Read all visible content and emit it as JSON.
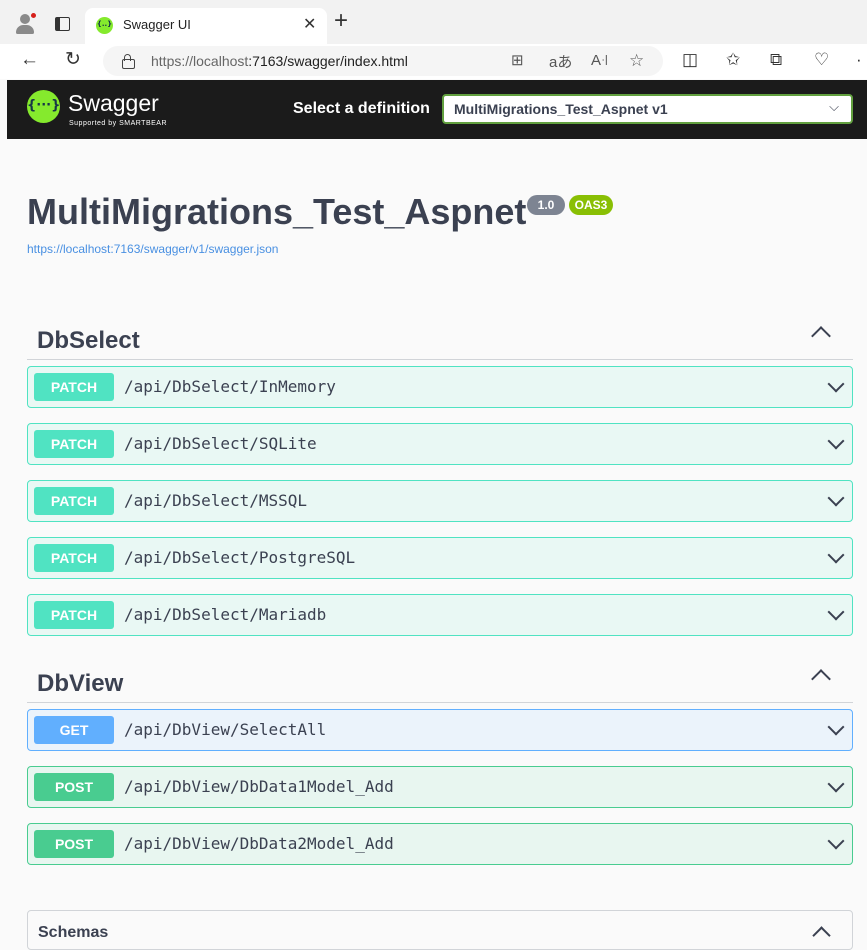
{
  "browser": {
    "tab_title": "Swagger UI",
    "tab_close": "✕",
    "new_tab": "+",
    "url_host": "https://localhost",
    "url_rest": ":7163/swagger/index.html"
  },
  "swagger": {
    "brand": "Swagger",
    "brand_sub": "Supported by SMARTBEAR",
    "definition_label": "Select a definition",
    "definition_value": "MultiMigrations_Test_Aspnet v1"
  },
  "info": {
    "title": "MultiMigrations_Test_Aspnet",
    "version": "1.0",
    "oas": "OAS3",
    "spec_url": "https://localhost:7163/swagger/v1/swagger.json"
  },
  "sections": [
    {
      "name": "DbSelect",
      "operations": [
        {
          "method": "PATCH",
          "path": "/api/DbSelect/InMemory"
        },
        {
          "method": "PATCH",
          "path": "/api/DbSelect/SQLite"
        },
        {
          "method": "PATCH",
          "path": "/api/DbSelect/MSSQL"
        },
        {
          "method": "PATCH",
          "path": "/api/DbSelect/PostgreSQL"
        },
        {
          "method": "PATCH",
          "path": "/api/DbSelect/Mariadb"
        }
      ]
    },
    {
      "name": "DbView",
      "operations": [
        {
          "method": "GET",
          "path": "/api/DbView/SelectAll"
        },
        {
          "method": "POST",
          "path": "/api/DbView/DbData1Model_Add"
        },
        {
          "method": "POST",
          "path": "/api/DbView/DbData2Model_Add"
        }
      ]
    }
  ],
  "schemas": {
    "label": "Schemas"
  },
  "colors": {
    "patch": "#50e3c2",
    "get": "#61affe",
    "post": "#49cc90",
    "swagger_green": "#85ea2d",
    "topbar": "#1b1b1b"
  }
}
